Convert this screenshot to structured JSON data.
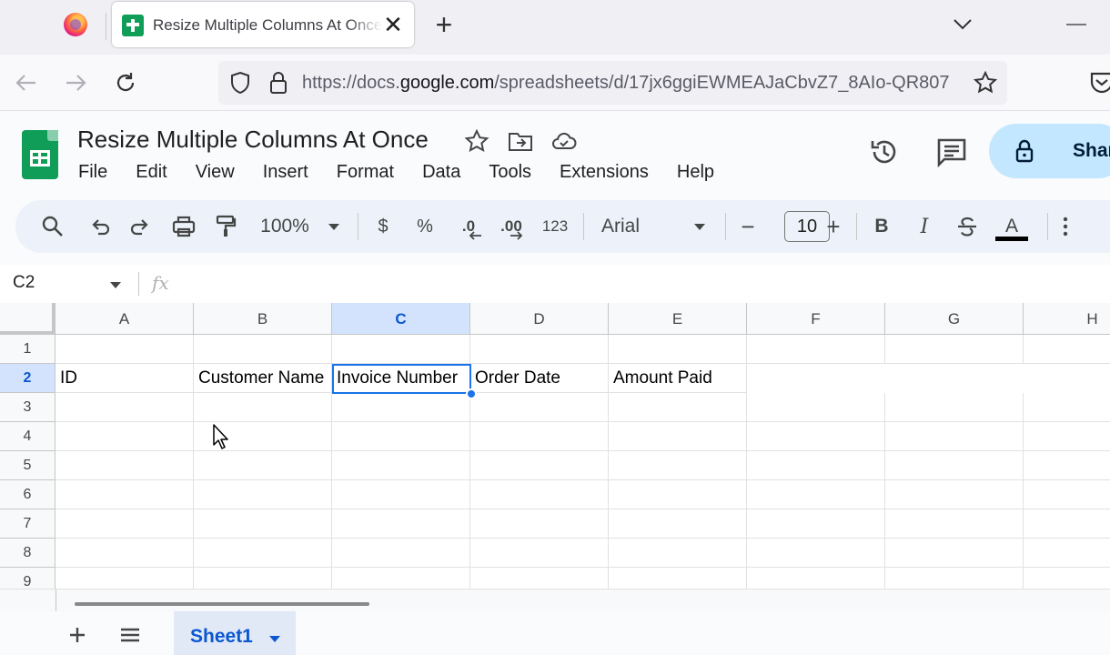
{
  "browser": {
    "tab_title": "Resize Multiple Columns At Once",
    "url_prefix": "https://docs.",
    "url_host": "google.com",
    "url_path": "/spreadsheets/d/17jx6ggiEWMEAJaCbvZ7_8AIo-QR807",
    "close_glyph": "✕",
    "new_tab_glyph": "+"
  },
  "app": {
    "doc_title": "Resize Multiple Columns At Once",
    "menu": [
      "File",
      "Edit",
      "View",
      "Insert",
      "Format",
      "Data",
      "Tools",
      "Extensions",
      "Help"
    ],
    "share_label": "Share"
  },
  "toolbar": {
    "zoom": "100%",
    "currency": "$",
    "percent": "%",
    "decrease_decimal": ".0",
    "increase_decimal": ".00",
    "number_format": "123",
    "font": "Arial",
    "font_size": "10",
    "minus": "−",
    "plus": "+",
    "bold": "B",
    "italic": "I",
    "text_color_letter": "A",
    "text_color": "#000000"
  },
  "formula_bar": {
    "name_box": "C2",
    "fx": "fx",
    "value": ""
  },
  "grid": {
    "columns": [
      "A",
      "B",
      "C",
      "D",
      "E",
      "F",
      "G",
      "H"
    ],
    "rows": [
      "1",
      "2",
      "3",
      "4",
      "5",
      "6",
      "7",
      "8",
      "9"
    ],
    "selected_cell": "C2",
    "row2": {
      "A": "ID",
      "B": "Customer Name",
      "C": "Invoice Number",
      "D": "Order Date",
      "E": "Amount Paid"
    }
  },
  "sheets": {
    "add_glyph": "+",
    "tabs": [
      "Sheet1"
    ]
  },
  "colors": {
    "accent": "#1a73e8",
    "sheets_green": "#0f9d58",
    "share_bg": "#c2e7ff",
    "selection_header": "#d3e3fd"
  }
}
